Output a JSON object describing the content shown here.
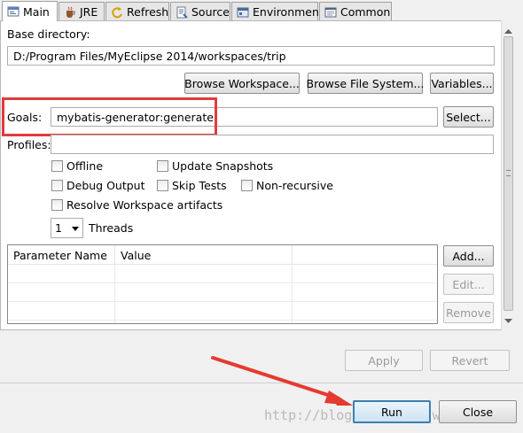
{
  "tabs": [
    {
      "label": "Main",
      "icon": "main-config-icon",
      "active": true
    },
    {
      "label": "JRE",
      "icon": "jre-icon",
      "active": false
    },
    {
      "label": "Refresh",
      "icon": "refresh-icon",
      "active": false
    },
    {
      "label": "Source",
      "icon": "source-icon",
      "active": false
    },
    {
      "label": "Environment",
      "icon": "environment-icon",
      "active": false
    },
    {
      "label": "Common",
      "icon": "common-icon",
      "active": false
    }
  ],
  "base_directory": {
    "label": "Base directory:",
    "value": "D:/Program Files/MyEclipse  2014/workspaces/trip",
    "browse_workspace": "Browse Workspace...",
    "browse_file_system": "Browse File System...",
    "variables": "Variables..."
  },
  "goals": {
    "label": "Goals:",
    "value": "mybatis-generator:generate",
    "select": "Select..."
  },
  "profiles": {
    "label": "Profiles:",
    "value": ""
  },
  "options": {
    "offline": "Offline",
    "update_snapshots": "Update Snapshots",
    "debug_output": "Debug Output",
    "skip_tests": "Skip Tests",
    "non_recursive": "Non-recursive",
    "resolve_workspace": "Resolve Workspace artifacts"
  },
  "threads": {
    "value": "1",
    "label": "Threads"
  },
  "params_table": {
    "columns": [
      "Parameter Name",
      "Value",
      ""
    ],
    "rows": [],
    "add": "Add...",
    "edit": "Edit...",
    "remove": "Remove"
  },
  "footer": {
    "apply": "Apply",
    "revert": "Revert",
    "run": "Run",
    "close": "Close"
  },
  "watermark": "http://blog.csdn.net/wmf92",
  "colors": {
    "highlight": "#e03c3c",
    "arrow": "#e53a2f",
    "default_button": "#3c7fb1"
  }
}
